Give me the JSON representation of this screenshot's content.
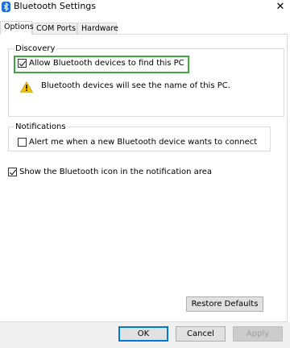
{
  "window": {
    "title": "Bluetooth Settings",
    "close_label": "✕"
  },
  "tabs": [
    {
      "label": "Options",
      "active": true
    },
    {
      "label": "COM Ports",
      "active": false
    },
    {
      "label": "Hardware",
      "active": false
    }
  ],
  "discovery": {
    "legend": "Discovery",
    "allow_label": "Allow Bluetooth devices to find this PC",
    "allow_checked": true,
    "warning_text": "Bluetooth devices will see the name of this PC."
  },
  "notifications": {
    "legend": "Notifications",
    "alert_label": "Alert me when a new Bluetooth device wants to connect",
    "alert_checked": false
  },
  "tray_icon": {
    "label": "Show the Bluetooth icon in the notification area",
    "checked": true
  },
  "buttons": {
    "restore_defaults": "Restore Defaults",
    "ok": "OK",
    "cancel": "Cancel",
    "apply": "Apply"
  },
  "colors": {
    "highlight": "#3fa83f",
    "bluetooth": "#1e6fd9",
    "warning": "#f2c200",
    "focus": "#0078d7"
  }
}
